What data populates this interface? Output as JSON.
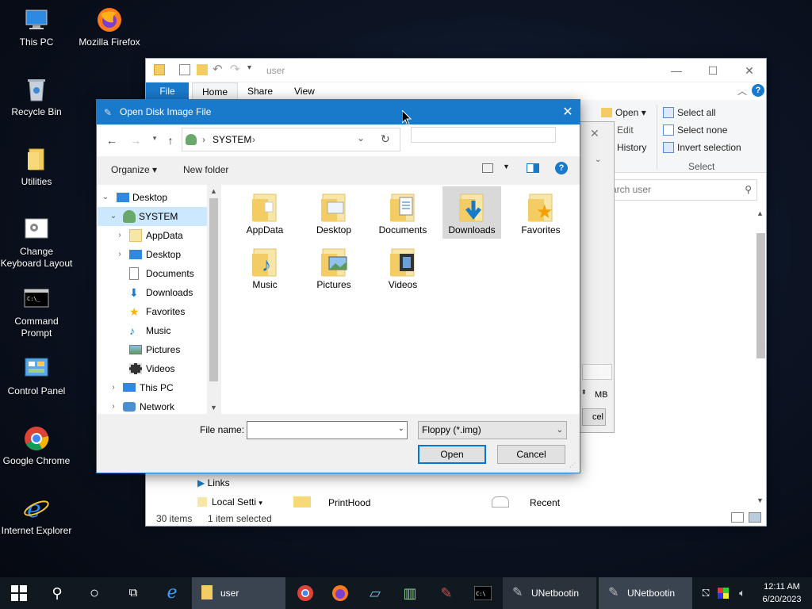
{
  "desktop_icons": [
    {
      "label": "This PC"
    },
    {
      "label": "Mozilla Firefox"
    },
    {
      "label": "Recycle Bin"
    },
    {
      "label": "Utilities"
    },
    {
      "label": "Change Keyboard Layout"
    },
    {
      "label": "Command Prompt"
    },
    {
      "label": "Control Panel"
    },
    {
      "label": "Google Chrome"
    },
    {
      "label": "Internet Explorer"
    }
  ],
  "explorer": {
    "title": "user",
    "tabs": [
      "File",
      "Home",
      "Share",
      "View"
    ],
    "ribbon": {
      "open": "Open",
      "edit": "Edit",
      "history": "History",
      "select_all": "Select all",
      "select_none": "Select none",
      "invert_selection": "Invert selection",
      "select_group": "Select"
    },
    "search_placeholder": "arch user",
    "partial_text_to": "to",
    "partial_mb": "MB",
    "partial_cel": "cel",
    "nav_items": [
      "Links",
      "Local Setti"
    ],
    "items": [
      "PrintHood",
      "Recent"
    ],
    "status_count": "30 items",
    "status_selected": "1 item selected"
  },
  "dialog": {
    "title": "Open Disk Image File",
    "address": {
      "path": "SYSTEM"
    },
    "toolbar": {
      "organize": "Organize",
      "new_folder": "New folder"
    },
    "tree": [
      {
        "label": "Desktop",
        "level": 0,
        "expanded": true
      },
      {
        "label": "SYSTEM",
        "level": 1,
        "expanded": true,
        "selected": true
      },
      {
        "label": "AppData",
        "level": 2,
        "expandable": true
      },
      {
        "label": "Desktop",
        "level": 2,
        "expandable": true
      },
      {
        "label": "Documents",
        "level": 2
      },
      {
        "label": "Downloads",
        "level": 2
      },
      {
        "label": "Favorites",
        "level": 2
      },
      {
        "label": "Music",
        "level": 2
      },
      {
        "label": "Pictures",
        "level": 2
      },
      {
        "label": "Videos",
        "level": 2
      },
      {
        "label": "This PC",
        "level": 1,
        "expandable": true
      },
      {
        "label": "Network",
        "level": 1,
        "expandable": true
      }
    ],
    "files": [
      {
        "label": "AppData"
      },
      {
        "label": "Desktop"
      },
      {
        "label": "Documents"
      },
      {
        "label": "Downloads",
        "selected": true
      },
      {
        "label": "Favorites"
      },
      {
        "label": "Music"
      },
      {
        "label": "Pictures"
      },
      {
        "label": "Videos"
      }
    ],
    "file_name_label": "File name:",
    "file_name_value": "",
    "filter": "Floppy (*.img)",
    "open_button": "Open",
    "cancel_button": "Cancel"
  },
  "taskbar": {
    "apps": [
      {
        "label": "user"
      },
      {
        "label": "UNetbootin"
      },
      {
        "label": "UNetbootin"
      }
    ],
    "time": "12:11 AM",
    "date": "6/20/2023"
  },
  "colors": {
    "accent": "#1979ca",
    "folder": "#f3cd63",
    "selection": "#cce8ff"
  }
}
